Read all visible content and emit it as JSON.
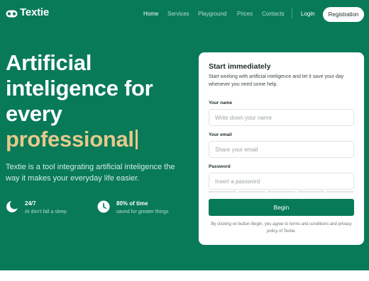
{
  "brand": {
    "name": "Textie",
    "colors": {
      "primary": "#087a58",
      "accent": "#e5c98b"
    }
  },
  "nav": {
    "items": [
      "Home",
      "Services",
      "Playground",
      "Prices",
      "Contacts"
    ],
    "active": "Home",
    "login": "Login",
    "registration": "Registration"
  },
  "hero": {
    "headline_line1": "Artificial",
    "headline_line2": "inteligence for",
    "headline_line3": "every",
    "headline_accent": "professional",
    "subtitle": "Textie is a tool integrating artificial inteligence the way it makes your everyday life easier.",
    "stats": [
      {
        "icon": "moon-icon",
        "title": "24/7",
        "desc": "AI don't fall a sleep"
      },
      {
        "icon": "clock-icon",
        "title": "80% of time",
        "desc": "saved for greater things"
      }
    ]
  },
  "form": {
    "title": "Start immediately",
    "description": "Start working with artificial inteligence and let it save your day whenever you need some help.",
    "name_label": "Your name",
    "name_placeholder": "Write down your name",
    "email_label": "Your email",
    "email_placeholder": "Share your email",
    "password_label": "Password",
    "password_placeholder": "Insert a password",
    "submit": "Begin",
    "note": "By clicking on button Begin, you agree to terms and conditions and privacy policy of Textie."
  }
}
